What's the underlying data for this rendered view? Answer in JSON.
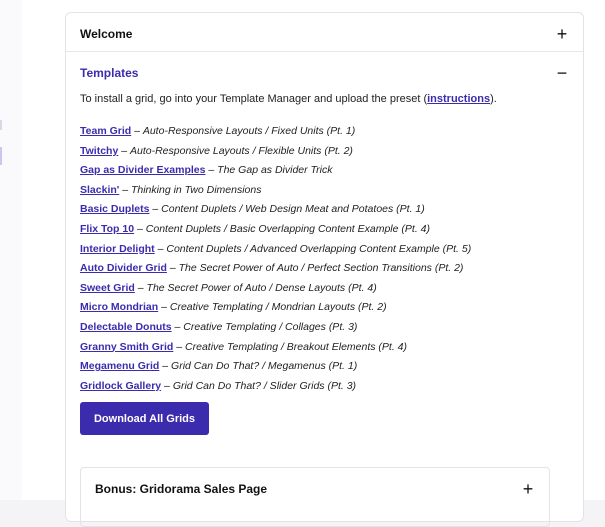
{
  "accordion": {
    "welcome": {
      "title": "Welcome",
      "icon": "plus-icon",
      "toggle": "+"
    },
    "templates": {
      "title": "Templates",
      "icon": "minus-icon",
      "toggle": "−",
      "intro_before": "To install a grid, go into your Template Manager and upload the preset (",
      "intro_link": "instructions",
      "intro_after": ").",
      "items": [
        {
          "link": "Team Grid",
          "sep": " – ",
          "desc": "Auto-Responsive Layouts / Fixed Units (Pt. 1)"
        },
        {
          "link": "Twitchy",
          "sep": " – ",
          "desc": "Auto-Responsive Layouts / Flexible Units (Pt. 2)"
        },
        {
          "link": "Gap as Divider Examples",
          "sep": " – ",
          "desc": "The Gap as Divider Trick"
        },
        {
          "link": "Slackin'",
          "sep": " – ",
          "desc": "Thinking in Two Dimensions"
        },
        {
          "link": "Basic Duplets",
          "sep": " – ",
          "desc": "Content Duplets / Web Design Meat and Potatoes (Pt. 1)"
        },
        {
          "link": "Flix Top 10",
          "sep": " – ",
          "desc": "Content Duplets / Basic Overlapping Content Example (Pt. 4)"
        },
        {
          "link": "Interior Delight",
          "sep": " – ",
          "desc": "Content Duplets / Advanced Overlapping Content Example (Pt. 5)"
        },
        {
          "link": "Auto Divider Grid",
          "sep": " – ",
          "desc": "The Secret Power of Auto / Perfect Section Transitions (Pt. 2)"
        },
        {
          "link": "Sweet Grid",
          "sep": " – ",
          "desc": "The Secret Power of Auto / Dense Layouts (Pt. 4)"
        },
        {
          "link": "Micro Mondrian",
          "sep": " – ",
          "desc": "Creative Templating / Mondrian Layouts (Pt. 2)"
        },
        {
          "link": "Delectable Donuts",
          "sep": " – ",
          "desc": "Creative Templating / Collages (Pt. 3)"
        },
        {
          "link": "Granny Smith Grid",
          "sep": " – ",
          "desc": "Creative Templating / Breakout Elements (Pt. 4)"
        },
        {
          "link": "Megamenu Grid",
          "sep": " – ",
          "desc": "Grid Can Do That? / Megamenus (Pt. 1)"
        },
        {
          "link": "Gridlock Gallery",
          "sep": " – ",
          "desc": "Grid Can Do That? / Slider Grids (Pt. 3)"
        }
      ],
      "download_label": "Download All Grids",
      "bonus": {
        "title": "Bonus: Gridorama Sales Page",
        "icon": "plus-icon",
        "toggle": "+"
      }
    }
  },
  "colors": {
    "accent": "#3b2cad",
    "border": "#e2e2e8"
  }
}
